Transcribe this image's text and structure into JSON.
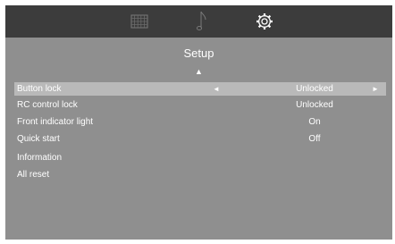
{
  "tabs": [
    {
      "icon": "picture-grid-icon",
      "active": false
    },
    {
      "icon": "music-note-icon",
      "active": false
    },
    {
      "icon": "gear-icon",
      "active": true
    }
  ],
  "menu": {
    "title": "Setup",
    "up_glyph": "▲",
    "left_glyph": "◄",
    "right_glyph": "►",
    "rows": [
      {
        "label": "Button lock",
        "value": "Unlocked",
        "selected": true
      },
      {
        "label": "RC control lock",
        "value": "Unlocked"
      },
      {
        "label": "Front indicator light",
        "value": "On"
      },
      {
        "label": "Quick start",
        "value": "Off"
      },
      {
        "label": "Information",
        "value": ""
      },
      {
        "label": "All reset",
        "value": ""
      }
    ]
  },
  "colors": {
    "background": "#8f8f8f",
    "tabbar": "#3c3c3c",
    "selected_row": "#b9b9b9",
    "text": "#ffffff"
  }
}
